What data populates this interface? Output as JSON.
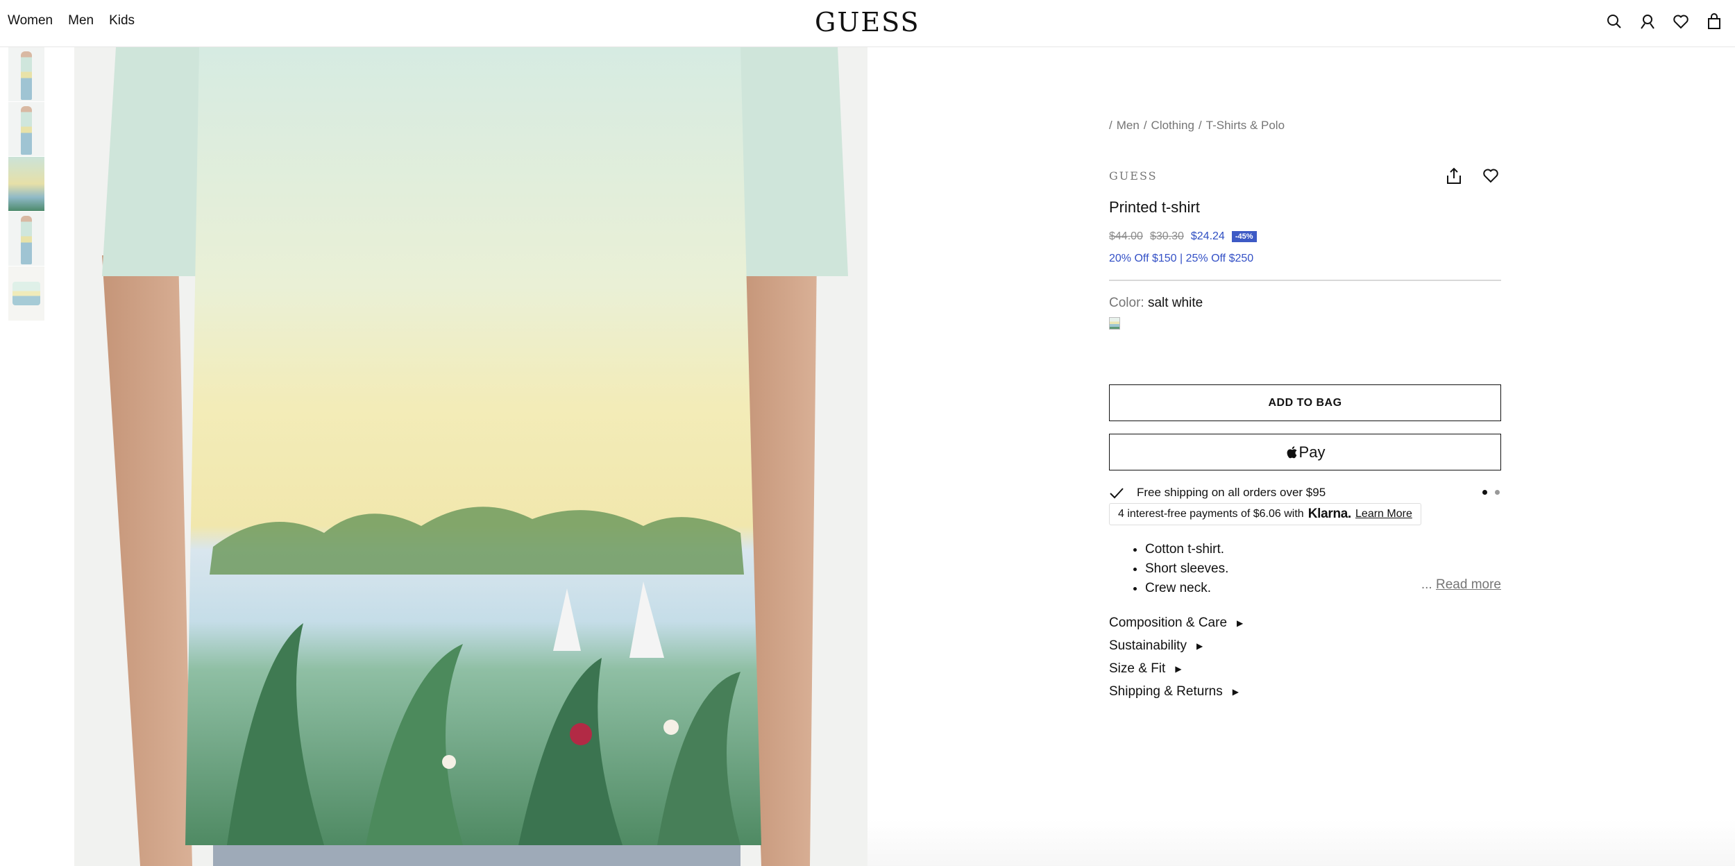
{
  "header": {
    "nav": [
      "Women",
      "Men",
      "Kids"
    ],
    "logo": "GUESS",
    "icons": [
      "search-icon",
      "account-icon",
      "wishlist-icon",
      "bag-icon"
    ]
  },
  "gallery": {
    "thumbnail_count": 5
  },
  "product": {
    "breadcrumb": {
      "sep": "/",
      "items": [
        "Men",
        "Clothing",
        "T-Shirts & Polo"
      ]
    },
    "brand": "GUESS",
    "title": "Printed t-shirt",
    "price": {
      "original": "$44.00",
      "previous": "$30.30",
      "current": "$24.24",
      "discount": "-45%"
    },
    "promo": "20% Off $150 | 25% Off $250",
    "color": {
      "label": "Color:",
      "value": "salt white"
    },
    "add_to_bag": "ADD TO BAG",
    "apple_pay": "Pay",
    "shipping": {
      "text": "Free shipping on all orders over $95",
      "slides": 2,
      "active_slide": 1
    },
    "klarna": {
      "prefix": "4 interest-free payments of $6.06 with",
      "logo": "Klarna.",
      "link": "Learn More"
    },
    "features": [
      "Cotton t-shirt.",
      "Short sleeves.",
      "Crew neck."
    ],
    "read_more": {
      "ellipsis": "...",
      "label": "Read more"
    },
    "accordions": [
      "Composition & Care",
      "Sustainability",
      "Size & Fit",
      "Shipping & Returns"
    ],
    "accent_color": "#3d5ac5"
  }
}
